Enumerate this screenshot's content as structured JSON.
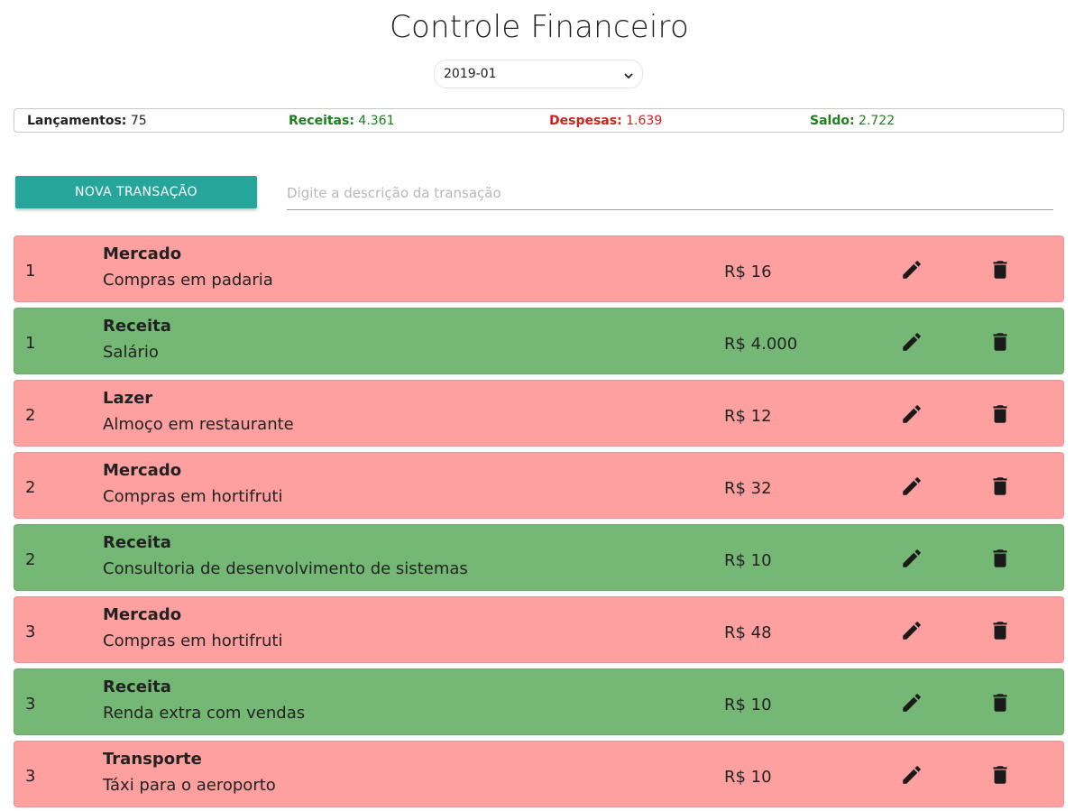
{
  "app": {
    "title": "Controle Financeiro",
    "period": "2019-01"
  },
  "summary": {
    "launches_label": "Lançamentos:",
    "launches_value": "75",
    "revenue_label": "Receitas:",
    "revenue_value": "4.361",
    "expense_label": "Despesas:",
    "expense_value": "1.639",
    "balance_label": "Saldo:",
    "balance_value": "2.722"
  },
  "toolbar": {
    "new_label": "NOVA TRANSAÇÃO",
    "search_placeholder": "Digite a descrição da transação",
    "search_value": ""
  },
  "colors": {
    "expense_row": "#ffa0a0",
    "revenue_row": "#75b875",
    "primary_button": "#26a69a"
  },
  "icons": {
    "edit": "pencil-icon",
    "delete": "trash-icon",
    "select": "chevron-down-icon"
  },
  "transactions": [
    {
      "day": "1",
      "category": "Mercado",
      "description": "Compras em padaria",
      "value": "R$ 16",
      "type": "expense"
    },
    {
      "day": "1",
      "category": "Receita",
      "description": "Salário",
      "value": "R$ 4.000",
      "type": "revenue"
    },
    {
      "day": "2",
      "category": "Lazer",
      "description": "Almoço em restaurante",
      "value": "R$ 12",
      "type": "expense"
    },
    {
      "day": "2",
      "category": "Mercado",
      "description": "Compras em hortifruti",
      "value": "R$ 32",
      "type": "expense"
    },
    {
      "day": "2",
      "category": "Receita",
      "description": "Consultoria de desenvolvimento de sistemas",
      "value": "R$ 10",
      "type": "revenue"
    },
    {
      "day": "3",
      "category": "Mercado",
      "description": "Compras em hortifruti",
      "value": "R$ 48",
      "type": "expense"
    },
    {
      "day": "3",
      "category": "Receita",
      "description": "Renda extra com vendas",
      "value": "R$ 10",
      "type": "revenue"
    },
    {
      "day": "3",
      "category": "Transporte",
      "description": "Táxi para o aeroporto",
      "value": "R$ 10",
      "type": "expense"
    }
  ]
}
